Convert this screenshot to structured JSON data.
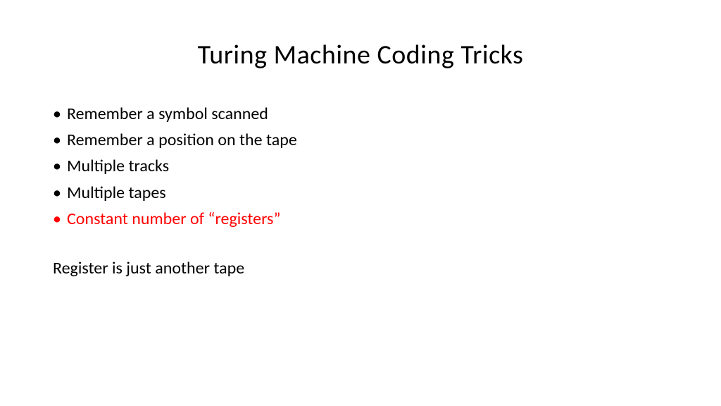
{
  "slide": {
    "title": "Turing Machine Coding Tricks",
    "bullets": [
      {
        "text": "Remember a symbol scanned",
        "highlighted": false
      },
      {
        "text": "Remember a position on the tape",
        "highlighted": false
      },
      {
        "text": "Multiple tracks",
        "highlighted": false
      },
      {
        "text": "Multiple tapes",
        "highlighted": false
      },
      {
        "text": "Constant number of “registers”",
        "highlighted": true
      }
    ],
    "footer": "Register is just another tape"
  }
}
